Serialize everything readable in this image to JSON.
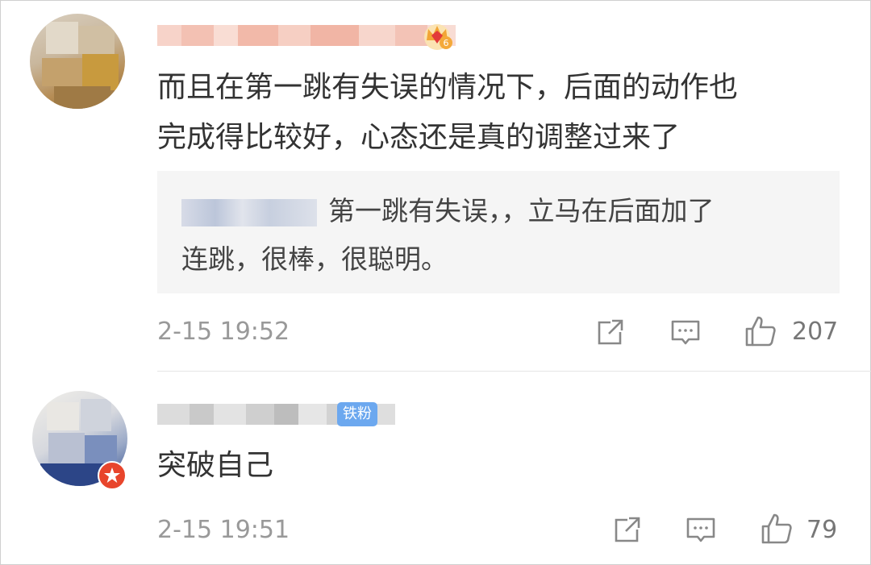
{
  "comments": [
    {
      "username": "",
      "text_line1": "而且在第一跳有失误的情况下，后面的动作也",
      "text_line2": "完成得比较好，心态还是真的调整过来了",
      "quote_text": "第一跳有失误，，立马在后面加了",
      "quote_text2": "连跳，很棒，很聪明。",
      "time": "2-15 19:52",
      "like_count": "207",
      "level_badge": "6",
      "icons": [
        "crown-icon",
        "share-icon",
        "reply-icon",
        "like-icon"
      ]
    },
    {
      "username": "",
      "fan_badge": "铁粉",
      "text": "突破自己",
      "time": "2-15 19:51",
      "like_count": "79",
      "icons": [
        "vip-star-icon",
        "share-icon",
        "reply-icon",
        "like-icon"
      ]
    }
  ],
  "colors": {
    "accent": "#6ca8ef",
    "text": "#333333",
    "meta": "#999999",
    "quote_bg": "#f5f5f5",
    "vip_red": "#e8452c"
  }
}
